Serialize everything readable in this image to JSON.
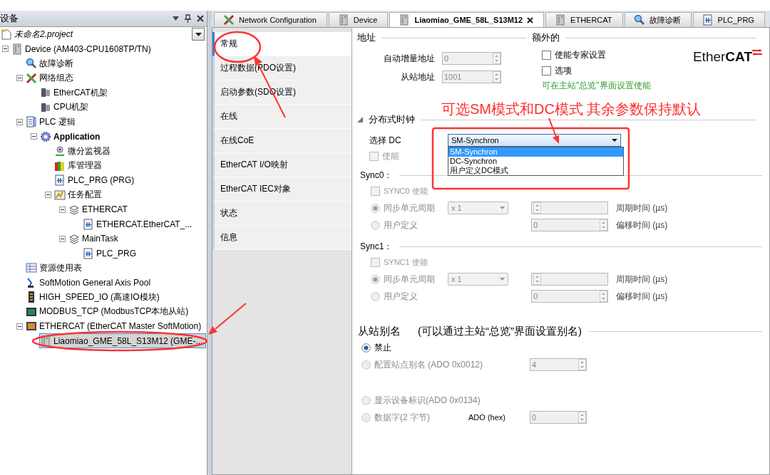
{
  "panel": {
    "title": "设备"
  },
  "tree": {
    "project": "未命名2.project",
    "items": [
      {
        "label": "Device (AM403-CPU1608TP/TN)",
        "kind": "device",
        "expanded": true,
        "selected": false,
        "children": [
          {
            "label": "故障诊断",
            "kind": "diagnosis",
            "selected": false
          },
          {
            "label": "网络组态",
            "kind": "network",
            "expanded": true,
            "selected": false,
            "children": [
              {
                "label": "EtherCAT机架",
                "kind": "rack",
                "selected": false
              },
              {
                "label": "CPU机架",
                "kind": "rack",
                "selected": false
              }
            ]
          },
          {
            "label": "PLC 逻辑",
            "kind": "logic",
            "expanded": true,
            "selected": false,
            "children": [
              {
                "label": "Application",
                "kind": "application",
                "active": true,
                "expanded": true,
                "selected": false,
                "children": [
                  {
                    "label": "微分监视器",
                    "kind": "monitor",
                    "selected": false
                  },
                  {
                    "label": "库管理器",
                    "kind": "library",
                    "selected": false
                  },
                  {
                    "label": "PLC_PRG (PRG)",
                    "kind": "program",
                    "selected": false
                  },
                  {
                    "label": "任务配置",
                    "kind": "taskconfig",
                    "expanded": true,
                    "selected": false,
                    "children": [
                      {
                        "label": "ETHERCAT",
                        "kind": "task",
                        "expanded": true,
                        "selected": false,
                        "children": [
                          {
                            "label": "ETHERCAT.EtherCAT_...",
                            "kind": "call",
                            "selected": false
                          }
                        ]
                      },
                      {
                        "label": "MainTask",
                        "kind": "task",
                        "expanded": true,
                        "selected": false,
                        "children": [
                          {
                            "label": "PLC_PRG",
                            "kind": "call",
                            "selected": false
                          }
                        ]
                      }
                    ]
                  }
                ]
              }
            ]
          },
          {
            "label": "资源使用表",
            "kind": "table",
            "selected": false
          },
          {
            "label": "SoftMotion General Axis Pool",
            "kind": "axis",
            "selected": false
          },
          {
            "label": "HIGH_SPEED_IO (高速IO模块)",
            "kind": "io",
            "selected": false
          },
          {
            "label": "MODBUS_TCP (ModbusTCP本地从站)",
            "kind": "modbus",
            "selected": false
          },
          {
            "label": "ETHERCAT (EtherCAT Master SoftMotion)",
            "kind": "master",
            "expanded": true,
            "selected": false,
            "children": [
              {
                "label": "Liaomiao_GME_58L_S13M12 (GME-...",
                "kind": "slave",
                "selected": true
              }
            ]
          }
        ]
      }
    ]
  },
  "tabs": [
    {
      "label": "Network Configuration",
      "kind": "network",
      "selected": false
    },
    {
      "label": "Device",
      "kind": "device",
      "selected": false
    },
    {
      "label": "Liaomiao_GME_58L_S13M12",
      "kind": "device",
      "selected": true,
      "closable": true
    },
    {
      "label": "ETHERCAT",
      "kind": "device",
      "selected": false
    },
    {
      "label": "故障诊断",
      "kind": "diagnosis",
      "selected": false
    },
    {
      "label": "PLC_PRG",
      "kind": "program",
      "selected": false
    }
  ],
  "nav": [
    {
      "label": "常规",
      "selected": true
    },
    {
      "label": "过程数据(PDO设置)",
      "selected": false
    },
    {
      "label": "启动参数(SDO设置)",
      "selected": false
    },
    {
      "label": "在线",
      "selected": false
    },
    {
      "label": "在线CoE",
      "selected": false
    },
    {
      "label": "EtherCAT I/O映射",
      "selected": false
    },
    {
      "label": "EtherCAT IEC对象",
      "selected": false
    },
    {
      "label": "状态",
      "selected": false
    },
    {
      "label": "信息",
      "selected": false
    }
  ],
  "address": {
    "title": "地址",
    "fields": [
      {
        "label": "自动增量地址",
        "value": "0",
        "disabled": true
      },
      {
        "label": "从站地址",
        "value": "1001",
        "disabled": true
      }
    ]
  },
  "extra": {
    "title": "额外的",
    "checks": [
      {
        "label": "使能专家设置",
        "checked": false
      },
      {
        "label": "选项",
        "checked": false
      }
    ],
    "note": "可在主站\"总览\"界面设置使能"
  },
  "logo": "Ether**CAT**",
  "dc": {
    "title": "分布式时钟",
    "expanded": true,
    "select_label": "选择 DC",
    "select_value": "SM-Synchron",
    "open": true,
    "options": [
      {
        "label": "SM-Synchron",
        "selected": true
      },
      {
        "label": "DC-Synchron",
        "selected": false
      },
      {
        "label": "用户定义DC模式",
        "selected": false
      }
    ],
    "enable": {
      "label": "使能",
      "checked": false,
      "disabled": true
    }
  },
  "syncs": [
    {
      "title": "Sync0：",
      "enable": {
        "label": "SYNC0 使能",
        "checked": false,
        "disabled": true
      },
      "rows": [
        {
          "label": "同步单元周期",
          "selected": true,
          "disabled": true,
          "combo": "x 1",
          "unit": "周期时间 (µs)"
        },
        {
          "label": "用户定义",
          "selected": false,
          "disabled": true,
          "spin": "0",
          "unit": "偏移时间 (µs)"
        }
      ]
    },
    {
      "title": "Sync1：",
      "enable": {
        "label": "SYNC1 使能",
        "checked": false,
        "disabled": true
      },
      "rows": [
        {
          "label": "同步单元周期",
          "selected": true,
          "disabled": true,
          "combo": "x 1",
          "unit": "周期时间 (µs)"
        },
        {
          "label": "用户定义",
          "selected": false,
          "disabled": true,
          "spin": "0",
          "unit": "偏移时间 (µs)"
        }
      ]
    }
  ],
  "alias": {
    "title": "从站别名",
    "note": "(可以通过主站“总览”界面设置别名)",
    "options": [
      {
        "label": "禁止",
        "selected": true,
        "disabled": false
      },
      {
        "label": "配置站点别名 (ADO 0x0012)",
        "selected": false,
        "disabled": true,
        "spin": "4"
      },
      {
        "label": "显示设备标识(ADO 0x0134)",
        "selected": false,
        "disabled": true
      },
      {
        "label": "数据字(2 字节)",
        "selected": false,
        "disabled": true,
        "field_label": "ADO (hex)",
        "spin": "0"
      }
    ]
  },
  "annotation": {
    "text": "可选SM模式和DC模式 其余参数保持默认"
  }
}
